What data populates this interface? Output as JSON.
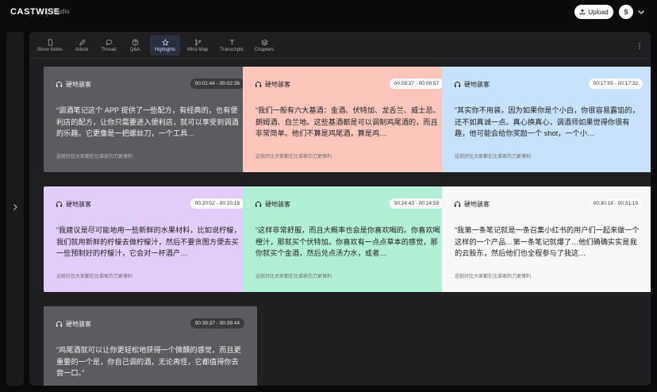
{
  "header": {
    "brand": "CASTWISE",
    "subtitle": "Studio",
    "upload_label": "Upload",
    "avatar_initial": "S"
  },
  "toolbar": {
    "items": [
      {
        "label": "Show Notes",
        "icon": "document-icon"
      },
      {
        "label": "Article",
        "icon": "article-icon"
      },
      {
        "label": "Thread",
        "icon": "chat-bubble-icon"
      },
      {
        "label": "Q&A",
        "icon": "question-icon"
      },
      {
        "label": "Highlights",
        "icon": "star-icon",
        "active": true
      },
      {
        "label": "Mind Map",
        "icon": "branch-icon"
      },
      {
        "label": "Transcripts",
        "icon": "text-icon"
      },
      {
        "label": "Chapters",
        "icon": "layers-icon"
      }
    ]
  },
  "highlights": [
    {
      "speaker": "硬地骇客",
      "time": "00:01:44 - 00:02:26",
      "theme": "gray",
      "quote": "“调酒笔记这个 APP 提供了一些配方，有经典的，也有便利店的配方，让你只需要进入便利店，就可以享受到调酒的乐趣。它更像是一把螺丝刀，一个工具…",
      "footer": "这就好比大家都在比谁家的刀更锋利"
    },
    {
      "speaker": "硬地骇客",
      "time": "00:09:37 - 00:09:57",
      "theme": "pink",
      "quote": "“我们一般有六大基酒：金酒、伏特加、龙舌兰、威士忌、朗姆酒、白兰地。这些基酒都是可以调制鸡尾酒的，而且非常简单。他们不算是鸡尾酒，算是鸡…",
      "footer": "这就好比大家都在比谁家的刀更锋利"
    },
    {
      "speaker": "硬地骇客",
      "time": "00:17:05 - 00:17:32",
      "theme": "blue",
      "quote": "“其实你不用装，因为如果你是个小白，你很容易露馅的，还不如真诚一点。真心换真心，调酒师如果觉得你很有趣，他可能会给你奖励一个 shot，一个小…",
      "footer": "这就好比大家都在比谁家的刀更锋利"
    },
    {
      "speaker": "硬地骇客",
      "time": "00:20:02 - 00:20:18",
      "theme": "purple",
      "quote": "“我建议是尽可能地用一些新鲜的水果材料，比如说柠檬，我们就用新鲜的柠檬去做柠檬汁，然后不要贪图方便去买一些预制好的柠檬汁，它会对一杯酒产…",
      "footer": "这就好比大家都在比谁家的刀更锋利"
    },
    {
      "speaker": "硬地骇客",
      "time": "00:24:43 - 00:24:59",
      "theme": "green",
      "quote": "“这样非常舒服，而且大概率也会是你喜欢喝的。你喜欢喝橙汁，那就买个伏特加。你喜欢有一点点草本的感觉，那你就买个金酒，然后兑点汤力水，或者…",
      "footer": "这就好比大家都在比谁家的刀更锋利"
    },
    {
      "speaker": "硬地骇客",
      "time": "00:30:18 - 00:31:19",
      "theme": "white",
      "quote": "“我第一条笔记就是一条召集小红书的用户们一起来做一个这样的一个产品…第一条笔记就爆了…他们确确实实是我的云股东，然后他们也全程参与了我这…",
      "footer": "这就好比大家都在比谁家的刀更锋利"
    },
    {
      "speaker": "硬地骇客",
      "time": "00:39:37 - 00:39:44",
      "theme": "gray",
      "quote": "“鸡尾酒就可以让你更轻松地获得一个微醺的感觉，而且更重要的一个是，你自己调的酒，无论再怪，它都值得你去尝一口。”",
      "footer": ""
    }
  ]
}
